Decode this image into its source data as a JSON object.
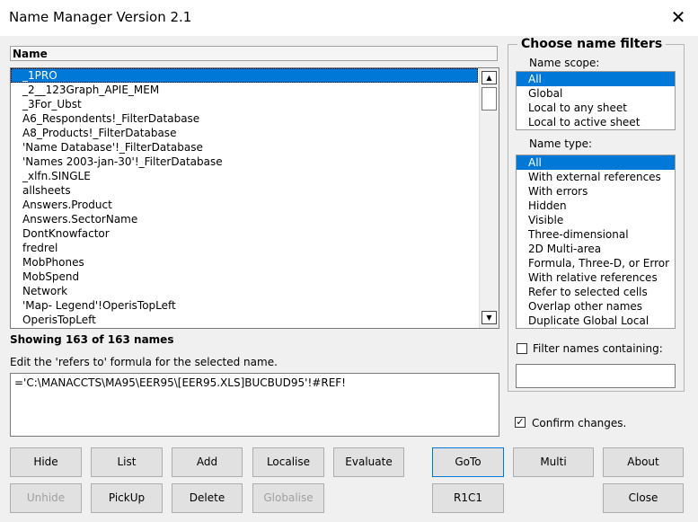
{
  "window": {
    "title": "Name Manager Version 2.1",
    "close_glyph": "✕"
  },
  "names_list": {
    "header": "Name",
    "items": [
      "_1PRO",
      "_2__123Graph_APIE_MEM",
      "_3For_Ubst",
      "A6_Respondents!_FilterDatabase",
      "A8_Products!_FilterDatabase",
      "'Name Database'!_FilterDatabase",
      "'Names 2003-jan-30'!_FilterDatabase",
      "_xlfn.SINGLE",
      "allsheets",
      "Answers.Product",
      "Answers.SectorName",
      "DontKnowfactor",
      "fredrel",
      "MobPhones",
      "MobSpend",
      "Network",
      "'Map- Legend'!OperisTopLeft",
      "OperisTopLeft"
    ],
    "selected_index": 0,
    "scroll_up_glyph": "▲",
    "scroll_down_glyph": "▼"
  },
  "status": {
    "showing": "Showing 163 of 163 names"
  },
  "formula": {
    "label": "Edit the 'refers to' formula for the selected name.",
    "value": "='C:\\MANACCTS\\MA95\\EER95\\[EER95.XLS]BUCBUD95'!#REF!"
  },
  "filters": {
    "title": "Choose name filters",
    "scope_label": "Name scope:",
    "scope_options": [
      "All",
      "Global",
      "Local to any sheet",
      "Local to active sheet"
    ],
    "type_label": "Name type:",
    "type_options": [
      "All",
      "With external references",
      "With errors",
      "Hidden",
      "Visible",
      "Three-dimensional",
      "2D Multi-area",
      "Formula, Three-D, or Error",
      "With relative references",
      "Refer to selected cells",
      "Overlap other names",
      "Duplicate Global Local"
    ],
    "filter_containing_label": "Filter names containing:",
    "filter_containing_checked": false,
    "filter_value": ""
  },
  "confirm": {
    "label": "Confirm changes.",
    "checked": true,
    "check_glyph": "✓"
  },
  "buttons": {
    "hide": "Hide",
    "list": "List",
    "add": "Add",
    "localise": "Localise",
    "evaluate": "Evaluate",
    "goto": "GoTo",
    "multi": "Multi",
    "about": "About",
    "unhide": "Unhide",
    "pickup": "PickUp",
    "delete": "Delete",
    "globalise": "Globalise",
    "r1c1": "R1C1",
    "close": "Close"
  }
}
